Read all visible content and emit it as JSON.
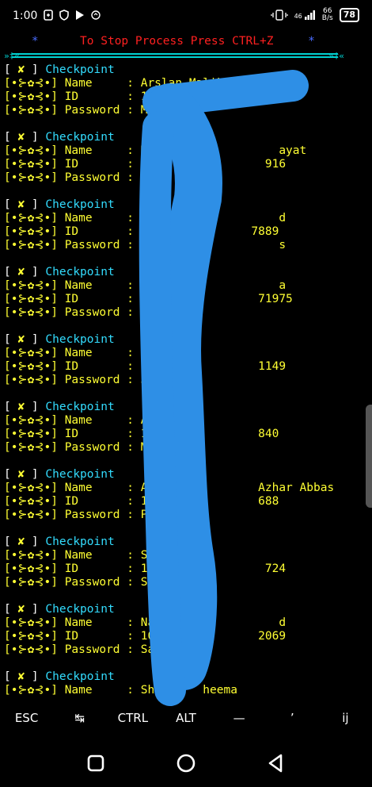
{
  "status_bar": {
    "time": "1:00",
    "network": "46",
    "speed_value": "66",
    "speed_unit": "B/s",
    "battery": "78"
  },
  "terminal": {
    "banner_star": "*",
    "banner_text": "To Stop Process Press CTRL+Z",
    "rule_end": "»‡«",
    "checkpoint_label": "Checkpoint",
    "name_label": "Name",
    "id_label": "ID",
    "password_label": "Password",
    "entries": [
      {
        "name": "Arslan Malik",
        "id": "100",
        "password": "Mai"
      },
      {
        "name": "Mus                 ayat",
        "id": "100               916",
        "password": "Mu"
      },
      {
        "name": "Sa                  d",
        "id": "10              7889",
        "password": "Wa                  s"
      },
      {
        "name": "Adr                 a",
        "id": "100              71975",
        "password": "Chi"
      },
      {
        "name": "Tayy",
        "id": "1000             1149",
        "password": "Jutt"
      },
      {
        "name": "Aya",
        "id": "100              840",
        "password": "Mai"
      },
      {
        "name": "Az               Azhar Abbas",
        "id": "10               688",
        "password": "Pa"
      },
      {
        "name": "Sh",
        "id": "10                724",
        "password": "Sha"
      },
      {
        "name": "Naw                 d",
        "id": "100              2069",
        "password": "Sai"
      },
      {
        "name": "Sher     heema",
        "id": null,
        "password": null
      }
    ]
  },
  "extra_keys": [
    "ESC",
    "↹",
    "CTRL",
    "ALT",
    "—",
    "’",
    "ij"
  ],
  "colors": {
    "background": "#000000",
    "text_yellow": "#ffff33",
    "text_cyan": "#33ddff",
    "banner_red": "#ff2020",
    "scribble_blue": "#2e8fe6"
  }
}
